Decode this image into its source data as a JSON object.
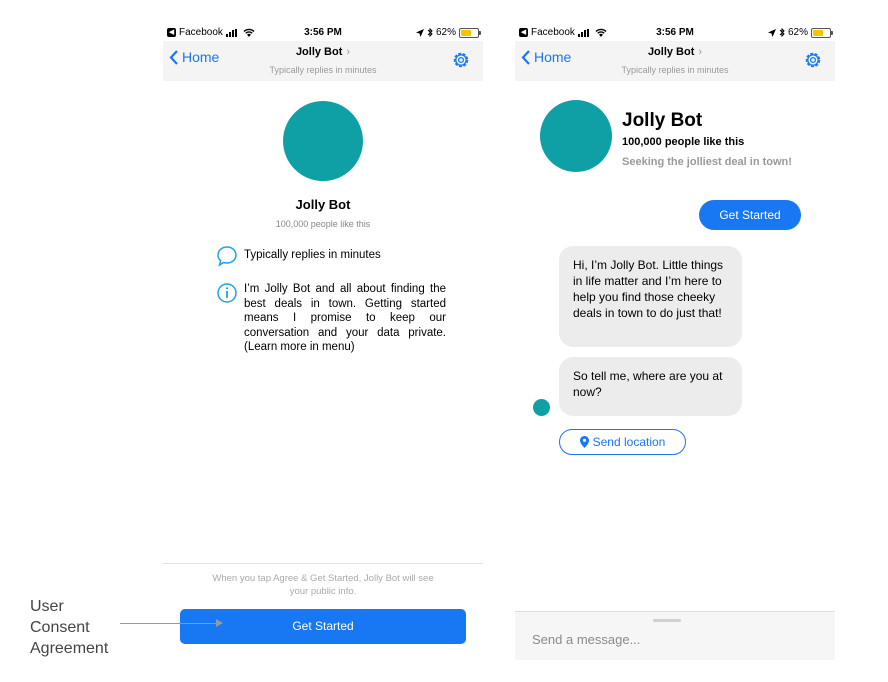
{
  "status_bar": {
    "app": "Facebook",
    "time": "3:56 PM",
    "battery": "62%",
    "battery_level": 0.62
  },
  "nav": {
    "back_label": "Home",
    "title": "Jolly Bot",
    "subtitle": "Typically replies in minutes"
  },
  "left": {
    "bot_name": "Jolly Bot",
    "likes": "100,000 people like this",
    "info_reply": "Typically replies in minutes",
    "info_about": "I’m Jolly Bot and all about finding the best deals in town. Getting started means I promise to keep our conversation and your data private. (Learn more in menu)",
    "consent_text": "When you tap Agree & Get Started, Jolly Bot will see your public info.",
    "cta": "Get Started"
  },
  "right": {
    "bot_name": "Jolly Bot",
    "likes": "100,000 people like this",
    "tagline": "Seeking the jolliest deal in town!",
    "user_message": "Get Started",
    "bot_messages": [
      "Hi, I’m Jolly Bot. Little things in life matter and I’m here to help you find those cheeky deals in town to do just that!",
      "So tell me, where are you at now?"
    ],
    "quick_reply": "Send location",
    "composer_placeholder": "Send a message..."
  },
  "annotation": {
    "line1": "User",
    "line2": "Consent",
    "line3": "Agreement"
  },
  "colors": {
    "brand_blue": "#1877f2",
    "bot_teal": "#0fa0a6",
    "bubble_gray": "#ececec"
  }
}
